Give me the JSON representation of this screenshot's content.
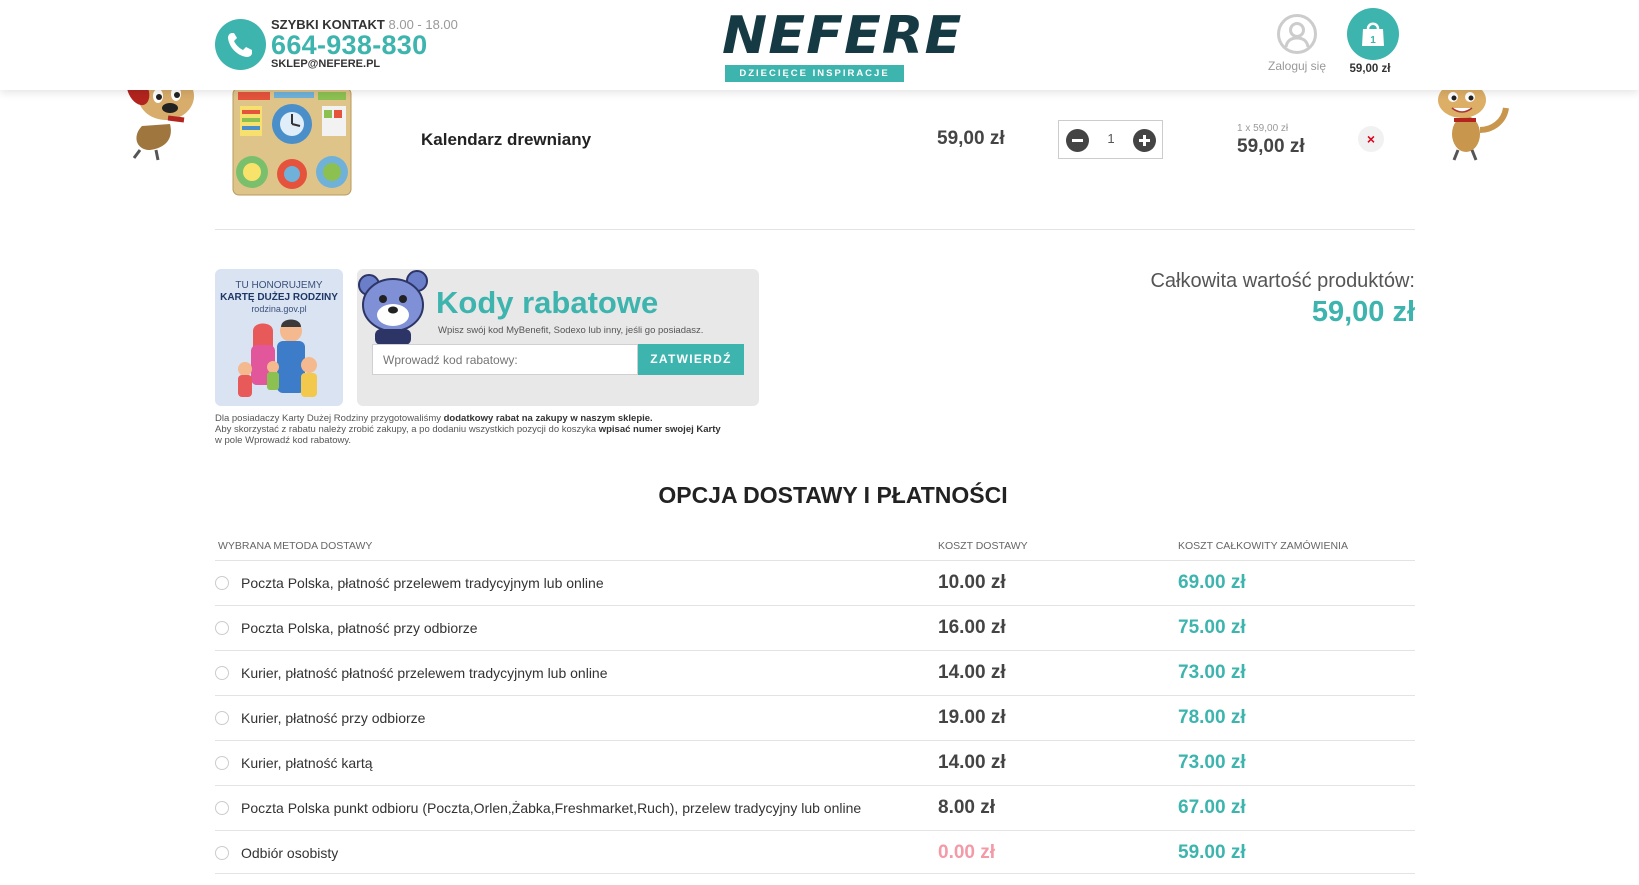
{
  "header": {
    "contact_label": "SZYBKI KONTAKT",
    "contact_hours": "8.00 - 18.00",
    "phone": "664-938-830",
    "email": "SKLEP@NEFERE.PL",
    "logo_text": "NEFERE",
    "logo_tagline": "DZIECIĘCE INSPIRACJE",
    "login_label": "Zaloguj się",
    "cart_count": "1",
    "cart_total": "59,00 zł"
  },
  "cart_item": {
    "name": "Kalendarz drewniany",
    "price": "59,00 zł",
    "quantity": "1",
    "line_detail": "1 x 59,00 zł",
    "line_total": "59,00 zł",
    "remove_symbol": "×"
  },
  "kdr": {
    "line1": "TU HONORUJEMY",
    "line2": "KARTĘ DUŻEJ RODZINY",
    "line3": "rodzina.gov.pl",
    "note_1a": "Dla posiadaczy Karty Dużej Rodziny przygotowaliśmy ",
    "note_1b": "dodatkowy rabat na zakupy w naszym sklepie.",
    "note_2a": "Aby skorzystać z rabatu należy zrobić zakupy, a po dodaniu wszystkich pozycji do koszyka ",
    "note_2b": "wpisać numer swojej Karty",
    "note_3": "w pole Wprowadź kod rabatowy."
  },
  "discount": {
    "title": "Kody rabatowe",
    "subtitle": "Wpisz swój kod MyBenefit, Sodexo lub inny, jeśli go posiadasz.",
    "placeholder": "Wprowadź kod rabatowy:",
    "submit_label": "ZATWIERDŹ"
  },
  "summary": {
    "label": "Całkowita wartość produktów:",
    "value": "59,00 zł"
  },
  "delivery": {
    "title": "OPCJA DOSTAWY I PŁATNOŚCI",
    "col_method": "WYBRANA METODA DOSTAWY",
    "col_cost": "KOSZT DOSTAWY",
    "col_total": "KOSZT CAŁKOWITY ZAMÓWIENIA",
    "options": [
      {
        "name": "Poczta Polska, płatność przelewem tradycyjnym lub online",
        "cost": "10.00 zł",
        "total": "69.00 zł"
      },
      {
        "name": "Poczta Polska, płatność przy odbiorze",
        "cost": "16.00 zł",
        "total": "75.00 zł"
      },
      {
        "name": "Kurier, płatność płatność przelewem tradycyjnym lub online",
        "cost": "14.00 zł",
        "total": "73.00 zł"
      },
      {
        "name": "Kurier, płatność przy odbiorze",
        "cost": "19.00 zł",
        "total": "78.00 zł"
      },
      {
        "name": "Kurier, płatność kartą",
        "cost": "14.00 zł",
        "total": "73.00 zł"
      },
      {
        "name": "Poczta Polska punkt odbioru (Poczta,Orlen,Żabka,Freshmarket,Ruch), przelew tradycyjny lub online",
        "cost": "8.00 zł",
        "total": "67.00 zł"
      },
      {
        "name": "Odbiór osobisty",
        "cost": "0.00 zł",
        "total": "59.00 zł"
      }
    ]
  },
  "colors": {
    "accent": "#3db4ae",
    "logo_dark": "#163a44",
    "free_cost": "#f39aa7",
    "remove": "#e0001a"
  },
  "icons": [
    "phone-icon",
    "user-icon",
    "shopping-bag-icon",
    "minus-icon",
    "plus-icon",
    "close-icon",
    "radio-icon"
  ]
}
